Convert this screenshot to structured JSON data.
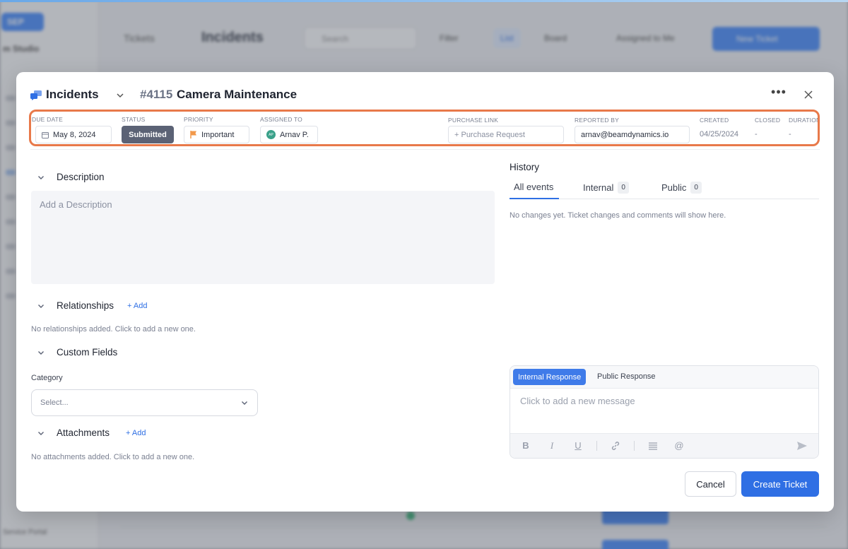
{
  "background": {
    "logo": "SEP",
    "studio": "m Studio",
    "breadcrumb": "Tickets",
    "title": "Incidents",
    "search_placeholder": "Search",
    "filter": "Filter",
    "list": "List",
    "board": "Board",
    "assigned": "Assigned to Me",
    "new_ticket": "New Ticket",
    "footer": "Service Portal"
  },
  "header": {
    "project": "Incidents",
    "ticket_number": "#4115",
    "ticket_title": "Camera Maintenance",
    "more_icon": "more-horizontal-icon",
    "close_icon": "close-icon"
  },
  "fields": {
    "due_date": {
      "label": "DUE DATE",
      "value": "May 8, 2024"
    },
    "status": {
      "label": "STATUS",
      "value": "Submitted"
    },
    "priority": {
      "label": "PRIORITY",
      "value": "Important",
      "color": "#f2994a"
    },
    "assigned_to": {
      "label": "ASSIGNED TO",
      "value": "Arnav P.",
      "initials": "AP"
    },
    "purchase_link": {
      "label": "PURCHASE LINK",
      "value": "+ Purchase Request"
    },
    "reported_by": {
      "label": "REPORTED BY",
      "value": "arnav@beamdynamics.io"
    },
    "created": {
      "label": "CREATED",
      "value": "04/25/2024"
    },
    "closed": {
      "label": "CLOSED",
      "value": "-"
    },
    "duration": {
      "label": "DURATION",
      "value": "-"
    }
  },
  "description": {
    "title": "Description",
    "placeholder": "Add a Description"
  },
  "relationships": {
    "title": "Relationships",
    "add": "+ Add",
    "empty": "No relationships added. Click to add a new one."
  },
  "custom_fields": {
    "title": "Custom Fields",
    "category_label": "Category",
    "category_placeholder": "Select..."
  },
  "attachments": {
    "title": "Attachments",
    "add": "+ Add",
    "empty": "No attachments added. Click to add a new one."
  },
  "history": {
    "title": "History",
    "tabs": [
      {
        "label": "All events",
        "count": null
      },
      {
        "label": "Internal",
        "count": "0"
      },
      {
        "label": "Public",
        "count": "0"
      }
    ],
    "empty": "No changes yet. Ticket changes and comments will show here."
  },
  "composer": {
    "tab_internal": "Internal Response",
    "tab_public": "Public Response",
    "placeholder": "Click to add a new message",
    "toolbar": [
      "bold-icon",
      "italic-icon",
      "underline-icon",
      "link-icon",
      "list-icon",
      "mention-icon",
      "send-icon"
    ]
  },
  "actions": {
    "cancel": "Cancel",
    "create": "Create Ticket"
  },
  "colors": {
    "accent": "#2f6fe4",
    "highlight": "#e8794a",
    "status_bg": "#5b6275"
  }
}
